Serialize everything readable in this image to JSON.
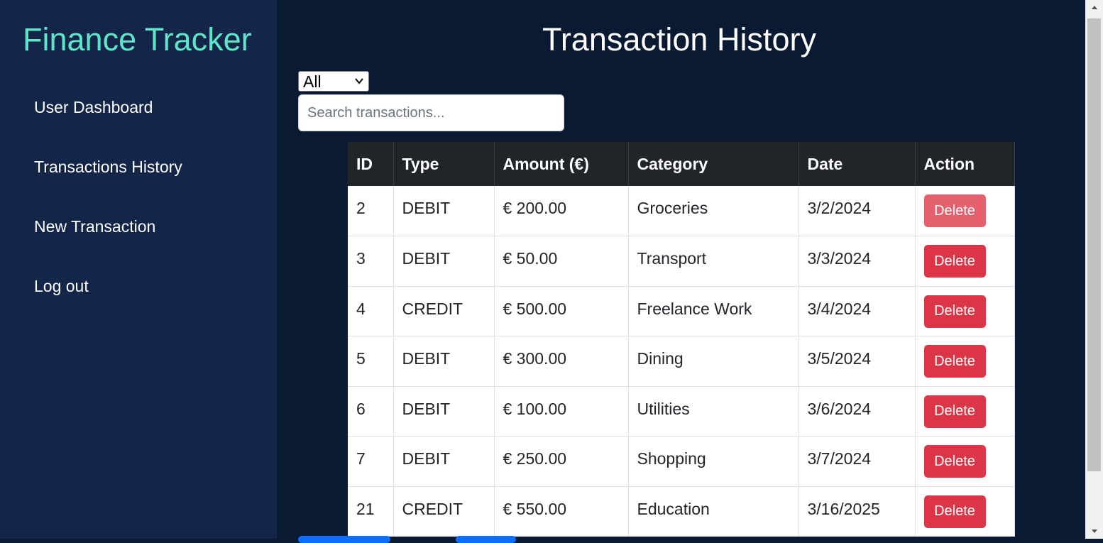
{
  "sidebar": {
    "brand": "Finance Tracker",
    "items": [
      {
        "label": "User Dashboard"
      },
      {
        "label": "Transactions History"
      },
      {
        "label": "New Transaction"
      },
      {
        "label": "Log out"
      }
    ]
  },
  "main": {
    "title": "Transaction History",
    "filter": {
      "selected": "All"
    },
    "search": {
      "placeholder": "Search transactions..."
    },
    "table": {
      "headers": [
        "ID",
        "Type",
        "Amount (€)",
        "Category",
        "Date",
        "Action"
      ],
      "rows": [
        {
          "id": "2",
          "type": "DEBIT",
          "amount": "€ 200.00",
          "category": "Groceries",
          "date": "3/2/2024",
          "action": "Delete"
        },
        {
          "id": "3",
          "type": "DEBIT",
          "amount": "€ 50.00",
          "category": "Transport",
          "date": "3/3/2024",
          "action": "Delete"
        },
        {
          "id": "4",
          "type": "CREDIT",
          "amount": "€ 500.00",
          "category": "Freelance Work",
          "date": "3/4/2024",
          "action": "Delete"
        },
        {
          "id": "5",
          "type": "DEBIT",
          "amount": "€ 300.00",
          "category": "Dining",
          "date": "3/5/2024",
          "action": "Delete"
        },
        {
          "id": "6",
          "type": "DEBIT",
          "amount": "€ 100.00",
          "category": "Utilities",
          "date": "3/6/2024",
          "action": "Delete"
        },
        {
          "id": "7",
          "type": "DEBIT",
          "amount": "€ 250.00",
          "category": "Shopping",
          "date": "3/7/2024",
          "action": "Delete"
        },
        {
          "id": "21",
          "type": "CREDIT",
          "amount": "€ 550.00",
          "category": "Education",
          "date": "3/16/2025",
          "action": "Delete"
        }
      ]
    }
  },
  "colors": {
    "sidebar_bg": "#13264a",
    "main_bg": "#0b1a33",
    "brand": "#5ee6c9",
    "delete": "#dc3545",
    "table_header": "#212529"
  }
}
